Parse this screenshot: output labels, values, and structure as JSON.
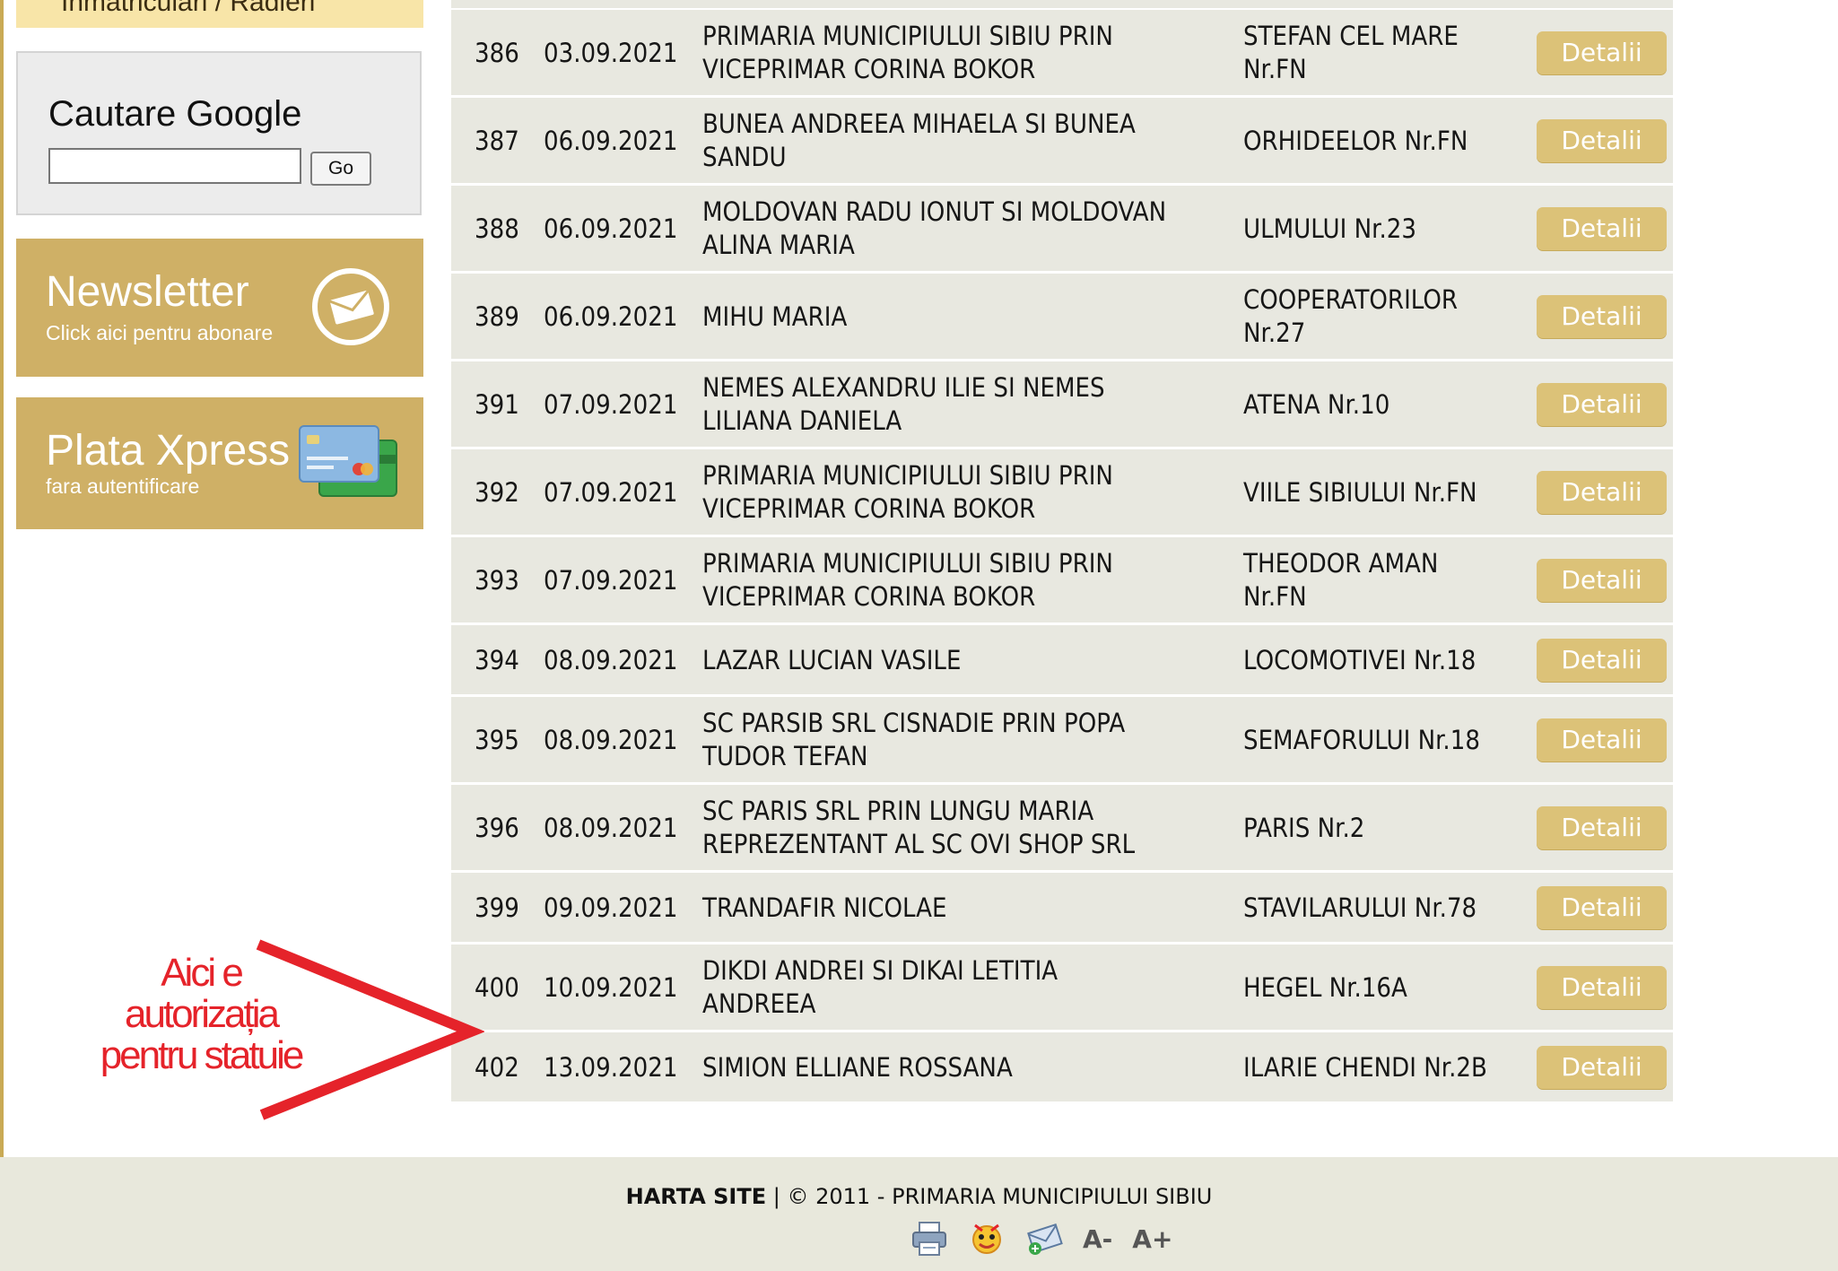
{
  "sidebar": {
    "nav_tab_label": "Inmatriculari / Radieri",
    "google_search": {
      "title": "Cautare Google",
      "input_value": "",
      "go_label": "Go"
    },
    "newsletter": {
      "title": "Newsletter",
      "subtitle": "Click aici pentru abonare",
      "icon": "envelope-icon"
    },
    "plata": {
      "title": "Plata Xpress",
      "subtitle": "fara autentificare",
      "icon": "credit-cards-icon"
    }
  },
  "table": {
    "button_label": "Detalii",
    "rows": [
      {
        "nr": "386",
        "date": "03.09.2021",
        "name": [
          "PRIMARIA MUNICIPIULUI SIBIU PRIN",
          "VICEPRIMAR CORINA BOKOR"
        ],
        "address": [
          "STEFAN CEL MARE",
          "Nr.FN"
        ]
      },
      {
        "nr": "387",
        "date": "06.09.2021",
        "name": [
          "BUNEA ANDREEA MIHAELA SI BUNEA",
          "SANDU"
        ],
        "address": [
          "ORHIDEELOR Nr.FN"
        ]
      },
      {
        "nr": "388",
        "date": "06.09.2021",
        "name": [
          "MOLDOVAN RADU IONUT SI MOLDOVAN",
          "ALINA MARIA"
        ],
        "address": [
          "ULMULUI Nr.23"
        ]
      },
      {
        "nr": "389",
        "date": "06.09.2021",
        "name": [
          "MIHU MARIA"
        ],
        "address": [
          "COOPERATORILOR",
          "Nr.27"
        ]
      },
      {
        "nr": "391",
        "date": "07.09.2021",
        "name": [
          "NEMES ALEXANDRU ILIE SI NEMES",
          "LILIANA DANIELA"
        ],
        "address": [
          "ATENA Nr.10"
        ]
      },
      {
        "nr": "392",
        "date": "07.09.2021",
        "name": [
          "PRIMARIA MUNICIPIULUI SIBIU PRIN",
          "VICEPRIMAR CORINA BOKOR"
        ],
        "address": [
          "VIILE SIBIULUI Nr.FN"
        ]
      },
      {
        "nr": "393",
        "date": "07.09.2021",
        "name": [
          "PRIMARIA MUNICIPIULUI SIBIU PRIN",
          "VICEPRIMAR CORINA BOKOR"
        ],
        "address": [
          "THEODOR AMAN",
          "Nr.FN"
        ]
      },
      {
        "nr": "394",
        "date": "08.09.2021",
        "name": [
          "LAZAR LUCIAN VASILE"
        ],
        "address": [
          "LOCOMOTIVEI Nr.18"
        ]
      },
      {
        "nr": "395",
        "date": "08.09.2021",
        "name": [
          "SC PARSIB SRL CISNADIE PRIN POPA",
          "TUDOR TEFAN"
        ],
        "address": [
          "SEMAFORULUI Nr.18"
        ]
      },
      {
        "nr": "396",
        "date": "08.09.2021",
        "name": [
          "SC PARIS SRL PRIN LUNGU MARIA",
          "REPREZENTANT AL SC OVI SHOP SRL"
        ],
        "address": [
          "PARIS Nr.2"
        ]
      },
      {
        "nr": "399",
        "date": "09.09.2021",
        "name": [
          "TRANDAFIR NICOLAE"
        ],
        "address": [
          "STAVILARULUI Nr.78"
        ]
      },
      {
        "nr": "400",
        "date": "10.09.2021",
        "name": [
          "DIKDI ANDREI SI DIKAI LETITIA",
          "ANDREEA"
        ],
        "address": [
          "HEGEL Nr.16A"
        ]
      },
      {
        "nr": "402",
        "date": "13.09.2021",
        "name": [
          "SIMION ELLIANE ROSSANA"
        ],
        "address": [
          "ILARIE CHENDI Nr.2B"
        ]
      }
    ]
  },
  "annotation": {
    "lines": [
      "Aici e",
      "autorizația",
      "pentru statuie"
    ],
    "color": "#e5232a"
  },
  "footer": {
    "sitemap_label": "HARTA SITE",
    "copyright": "| © 2011 - PRIMARIA MUNICIPIULUI SIBIU",
    "tools": [
      "print-icon",
      "bookmark-icon",
      "email-icon"
    ],
    "font_smaller": "A-",
    "font_larger": "A+"
  },
  "colors": {
    "accent_gold": "#cfb066",
    "button_gold": "#dcc278",
    "row_bg": "#e8e8e0",
    "footer_bg": "#e8e8dc"
  }
}
